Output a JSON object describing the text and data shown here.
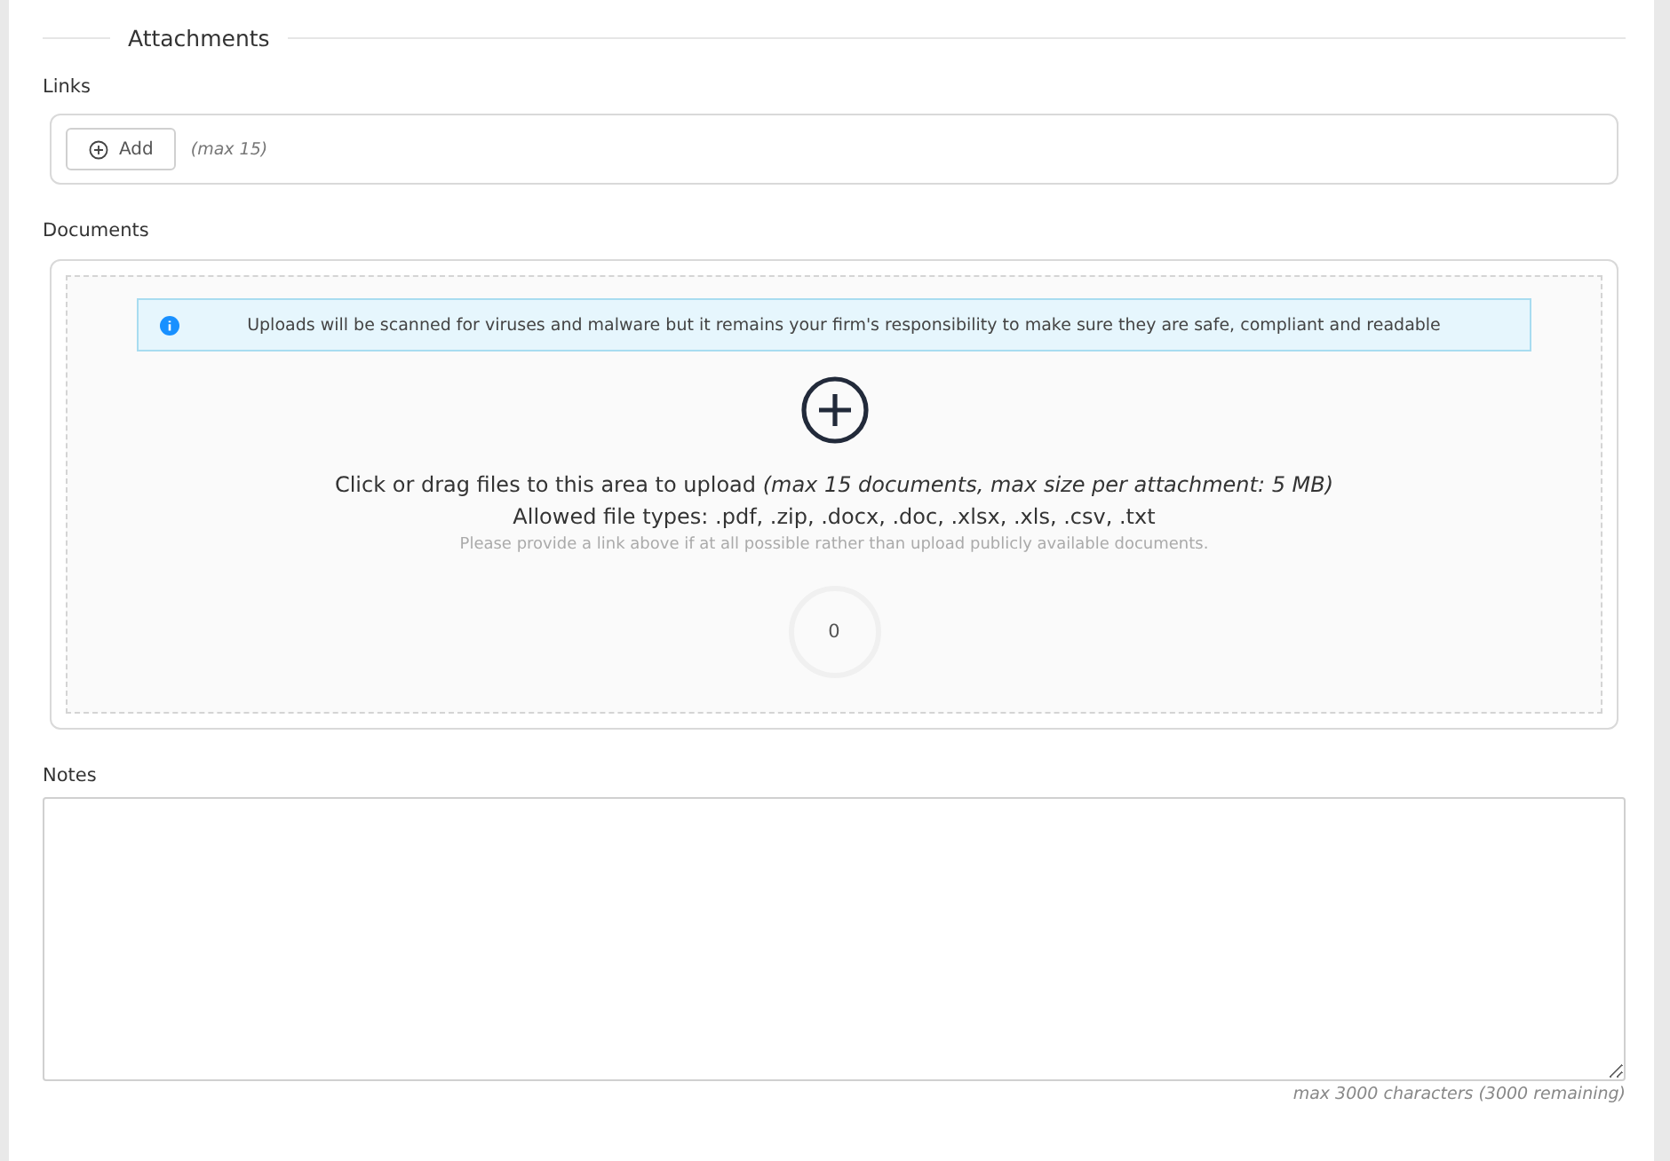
{
  "section": {
    "title": "Attachments"
  },
  "links": {
    "label": "Links",
    "add_button": "Add",
    "hint": "(max 15)"
  },
  "documents": {
    "label": "Documents",
    "notice": "Uploads will be scanned for viruses and malware but it remains your firm's responsibility to make sure they are safe, compliant and readable",
    "instruction": "Click or drag files to this area to upload *(max 15 documents, max size per attachment: 5 MB)*",
    "allowed_types": "Allowed file types: .pdf, .zip, .docx, .doc, .xlsx, .xls, .csv, .txt",
    "advice": "Please provide a link above if at all possible rather than upload publicly available documents.",
    "count": "0"
  },
  "notes": {
    "label": "Notes",
    "counter": "max 3000 characters (3000 remaining)"
  }
}
